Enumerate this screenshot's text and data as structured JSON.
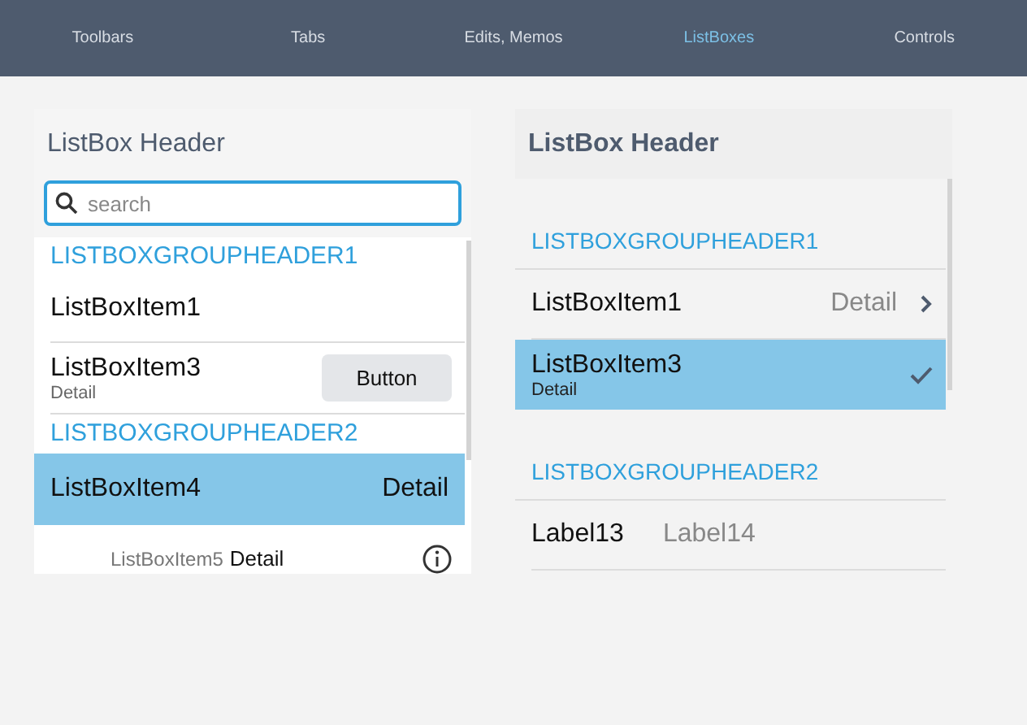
{
  "nav": [
    {
      "label": "Toolbars",
      "selected": false
    },
    {
      "label": "Tabs",
      "selected": false
    },
    {
      "label": "Edits, Memos",
      "selected": false
    },
    {
      "label": "ListBoxes",
      "selected": true
    },
    {
      "label": "Controls",
      "selected": false
    }
  ],
  "left": {
    "header": "ListBox Header",
    "search": {
      "placeholder": "search"
    },
    "rows": [
      {
        "kind": "group",
        "text": "LISTBOXGROUPHEADER1"
      },
      {
        "kind": "plain",
        "text": "ListBoxItem1",
        "selected": false,
        "info": false
      },
      {
        "kind": "subtitle",
        "text": "ListBoxItem3",
        "detail": "Detail",
        "button": "Button",
        "selected": false,
        "info": false
      },
      {
        "kind": "group",
        "text": "LISTBOXGROUPHEADER2"
      },
      {
        "kind": "right-detail",
        "text": "ListBoxItem4",
        "detail": "Detail",
        "selected": true,
        "info": false
      },
      {
        "kind": "indented",
        "text": "ListBoxItem5",
        "detail": "Detail",
        "selected": false,
        "info": true
      }
    ]
  },
  "right": {
    "header": "ListBox Header",
    "rows": [
      {
        "kind": "group",
        "text": "LISTBOXGROUPHEADER1"
      },
      {
        "kind": "right-detail",
        "text": "ListBoxItem1",
        "detail": "Detail",
        "chevron": true,
        "checked": false,
        "selected": false
      },
      {
        "kind": "subtitle",
        "text": "ListBoxItem3",
        "detail": "Detail",
        "chevron": false,
        "checked": true,
        "selected": true
      },
      {
        "kind": "group",
        "text": "LISTBOXGROUPHEADER2"
      },
      {
        "kind": "labels",
        "text": "Label13",
        "detail": "Label14",
        "chevron": false,
        "checked": false,
        "selected": false
      }
    ]
  }
}
